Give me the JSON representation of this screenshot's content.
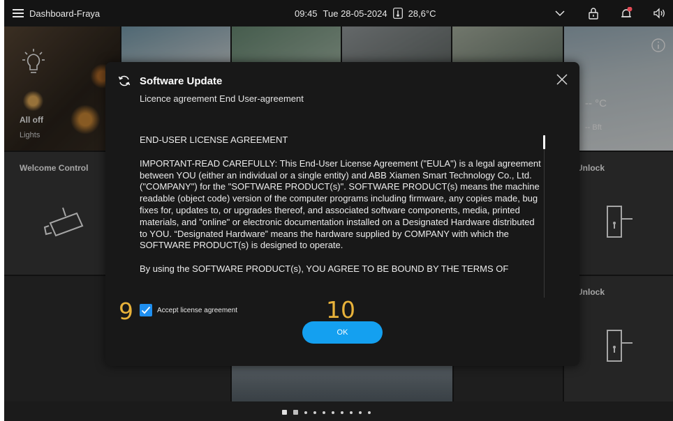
{
  "topbar": {
    "title": "Dashboard-Fraya",
    "time": "09:45",
    "date": "Tue 28-05-2024",
    "temperature": "28,6°C",
    "icons": [
      "menu-icon",
      "thermometer-icon",
      "chevron-down-icon",
      "lock-icon",
      "bell-icon",
      "speaker-icon"
    ]
  },
  "tiles": {
    "lights": {
      "title": "All off",
      "subtitle": "Lights"
    },
    "welcome": {
      "title": "Welcome Control"
    },
    "weather": {
      "temperature": "-- °C",
      "wind": "-- Bft"
    },
    "unlock_top": {
      "title": "Unlock"
    },
    "unlock_bottom": {
      "title": "Unlock"
    }
  },
  "dialog": {
    "title": "Software Update",
    "subtitle": "Licence agreement End User-agreement",
    "eula": {
      "heading": "END-USER LICENSE AGREEMENT",
      "paragraph1": "IMPORTANT-READ CAREFULLY: This End-User License Agreement (\"EULA\") is a legal agreement between YOU (either an individual or a single entity) and ABB Xiamen Smart Technology Co., Ltd. (\"COMPANY\") for the \"SOFTWARE PRODUCT(s)\". SOFTWARE PRODUCT(s) means the machine readable (object code) version of the computer programs including firmware, any copies made, bug fixes for, updates to, or upgrades thereof, and associated software components, media, printed materials, and \"online\" or electronic documentation installed on a Designated Hardware distributed to YOU. “Designated Hardware” means the hardware supplied by COMPANY with which the SOFTWARE PRODUCT(s) is designed to operate.",
      "paragraph2": "By using the SOFTWARE PRODUCT(s), YOU AGREE TO BE BOUND BY THE TERMS OF"
    },
    "accept_label": "Accept license agreement",
    "accept_checked": true,
    "ok_label": "OK"
  },
  "callouts": {
    "checkbox": "9",
    "ok": "10"
  },
  "pager": {
    "pages": 10,
    "current": 1
  },
  "colors": {
    "accent": "#14a0f0",
    "checkbox": "#1f8ff0",
    "callout": "#e8b23a",
    "dialog_bg": "#181818"
  }
}
